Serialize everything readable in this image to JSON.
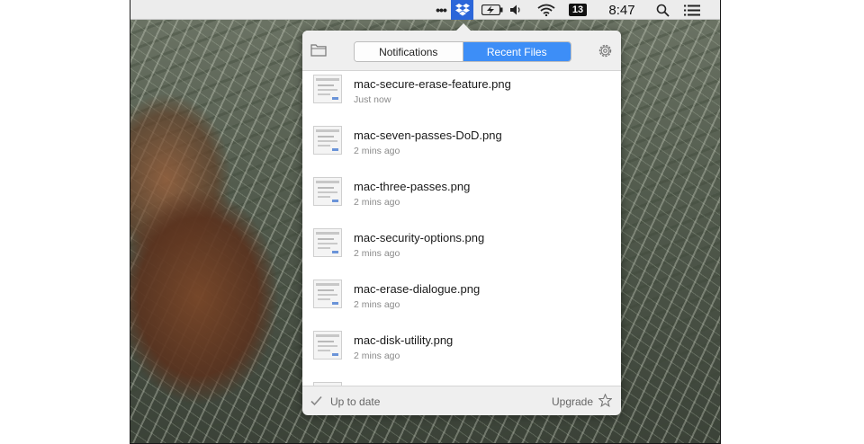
{
  "menubar": {
    "overflow_icon": "more-dots-icon",
    "badge": "13",
    "clock": "8:47",
    "icons": [
      "dropbox-icon",
      "battery-icon",
      "volume-icon",
      "wifi-icon",
      "search-icon",
      "list-icon"
    ]
  },
  "dropbox_popover": {
    "tabs": {
      "notifications": "Notifications",
      "recent_files": "Recent Files",
      "active": "recent_files"
    },
    "files": [
      {
        "name": "mac-secure-erase-feature.png",
        "time": "Just now"
      },
      {
        "name": "mac-seven-passes-DoD.png",
        "time": "2 mins ago"
      },
      {
        "name": "mac-three-passes.png",
        "time": "2 mins ago"
      },
      {
        "name": "mac-security-options.png",
        "time": "2 mins ago"
      },
      {
        "name": "mac-erase-dialogue.png",
        "time": "2 mins ago"
      },
      {
        "name": "mac-disk-utility.png",
        "time": "2 mins ago"
      }
    ],
    "footer": {
      "status": "Up to date",
      "upgrade": "Upgrade"
    }
  },
  "colors": {
    "accent": "#3d8ef7",
    "menubar_highlight": "#2b66d9"
  }
}
